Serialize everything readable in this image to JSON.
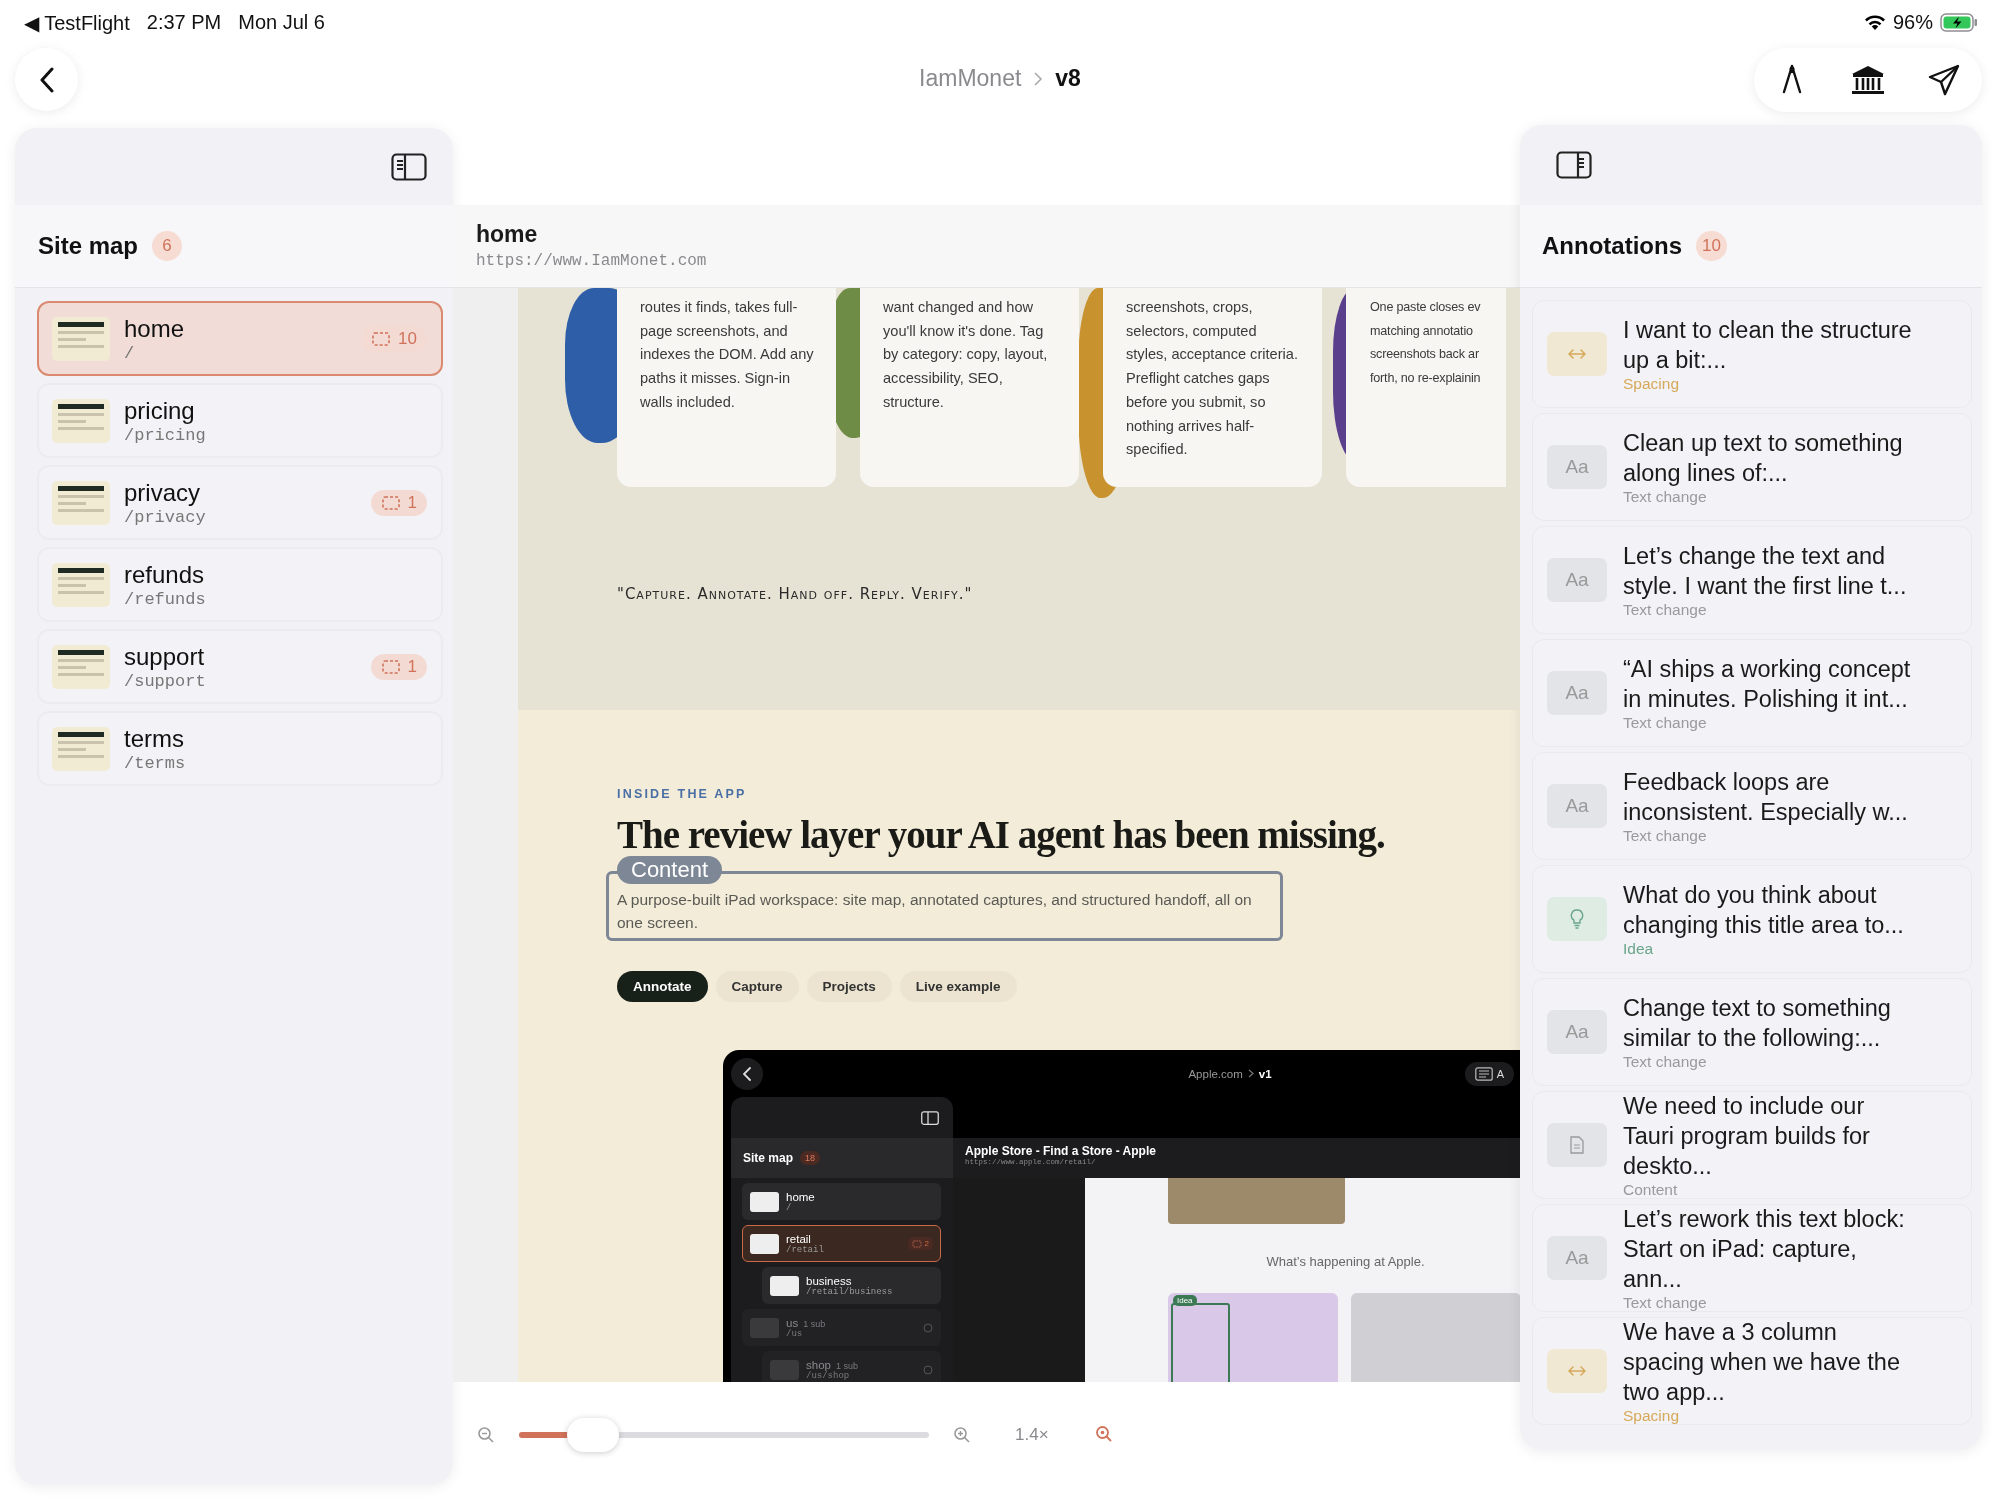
{
  "status_bar": {
    "back_app": "◀ TestFlight",
    "time": "2:37 PM",
    "date": "Mon Jul 6",
    "battery": "96%"
  },
  "breadcrumb": {
    "project": "IamMonet",
    "version": "v8"
  },
  "site_map": {
    "title": "Site map",
    "count": "6",
    "pages": [
      {
        "name": "home",
        "path": "/",
        "annotations": "10",
        "selected": true
      },
      {
        "name": "pricing",
        "path": "/pricing",
        "selected": false
      },
      {
        "name": "privacy",
        "path": "/privacy",
        "annotations": "1",
        "selected": false
      },
      {
        "name": "refunds",
        "path": "/refunds",
        "selected": false
      },
      {
        "name": "support",
        "path": "/support",
        "annotations": "1",
        "selected": false
      },
      {
        "name": "terms",
        "path": "/terms",
        "selected": false
      }
    ]
  },
  "page_header": {
    "title": "home",
    "url": "https://www.IamMonet.com"
  },
  "preview": {
    "cards": [
      {
        "lines": [
          "routes it finds, takes full-",
          "page screenshots, and",
          "indexes the DOM. Add any",
          "paths it misses. Sign-in",
          "walls included."
        ]
      },
      {
        "lines": [
          "want changed and how",
          "you'll know it's done. Tag",
          "by category: copy, layout,",
          "accessibility, SEO,",
          "structure."
        ]
      },
      {
        "lines": [
          "screenshots, crops,",
          "selectors, computed",
          "styles, acceptance criteria.",
          "Preflight catches gaps",
          "before you submit, so",
          "nothing arrives half-",
          "specified."
        ]
      },
      {
        "lines": [
          "One paste closes ev",
          "matching annotatio",
          "screenshots back ar",
          "forth, no re-explainin"
        ]
      }
    ],
    "quote": "\"Capture. Annotate. Hand off. Reply. Verify.\"",
    "eyebrow": "INSIDE THE APP",
    "headline": "The review layer your AI agent has been missing.",
    "selection_label": "Content",
    "paragraph": "A purpose-built iPad workspace: site map, annotated captures, and structured handoff, all on one screen.",
    "tabs": [
      {
        "label": "Annotate",
        "selected": true
      },
      {
        "label": "Capture",
        "selected": false
      },
      {
        "label": "Projects",
        "selected": false
      },
      {
        "label": "Live example",
        "selected": false
      }
    ],
    "embedded_app": {
      "breadcrumb": {
        "project": "Apple.com",
        "version": "v1"
      },
      "toolbar_label": "A",
      "site_map": {
        "title": "Site map",
        "count": "18",
        "pages": [
          {
            "name": "home",
            "path": "/",
            "selected": false,
            "dimmed": false
          },
          {
            "name": "retail",
            "path": "/retail",
            "annotations": "2",
            "selected": true,
            "dimmed": false,
            "children": [
              {
                "name": "business",
                "path": "/retail/business",
                "selected": false,
                "dimmed": false
              }
            ]
          },
          {
            "name": "us",
            "sub": "1 sub",
            "path": "/us",
            "selected": false,
            "dimmed": true,
            "children": [
              {
                "name": "shop",
                "sub": "1 sub",
                "path": "/us/shop",
                "selected": false,
                "dimmed": true
              }
            ]
          }
        ]
      },
      "page_title": "Apple Store - Find a Store - Apple",
      "page_url": "https://www.apple.com/retail/",
      "headline": "What’s happening at Apple.",
      "tag": "Idea"
    }
  },
  "zoom": {
    "level": 0.18,
    "reading": "1.4×"
  },
  "annotations": {
    "title": "Annotations",
    "count": "10",
    "items": [
      {
        "kind": "spacing",
        "text": "I want to clean the structure up a bit:...",
        "category": "Spacing"
      },
      {
        "kind": "text",
        "glyph": "Aa",
        "text": "Clean up text to something along lines of:...",
        "category": "Text change"
      },
      {
        "kind": "text",
        "glyph": "Aa",
        "text": "Let’s change the text and style. I want the first line t...",
        "category": "Text change"
      },
      {
        "kind": "text",
        "glyph": "Aa",
        "text": "“AI ships a working concept in minutes. Polishing it int...",
        "category": "Text change"
      },
      {
        "kind": "text",
        "glyph": "Aa",
        "text": "Feedback loops are inconsistent. Especially w...",
        "category": "Text change"
      },
      {
        "kind": "idea",
        "text": "What do you think about changing this title area to...",
        "category": "Idea"
      },
      {
        "kind": "text",
        "glyph": "Aa",
        "text": "Change text to something similar to the following:...",
        "category": "Text change"
      },
      {
        "kind": "content",
        "text": "We need to include our Tauri program builds for deskto...",
        "category": "Content"
      },
      {
        "kind": "text",
        "glyph": "Aa",
        "text": "Let’s rework this text block: Start on iPad: capture, ann...",
        "category": "Text change"
      },
      {
        "kind": "spacing",
        "text": "We have a 3 column spacing when we have the two app...",
        "category": "Spacing"
      }
    ]
  }
}
